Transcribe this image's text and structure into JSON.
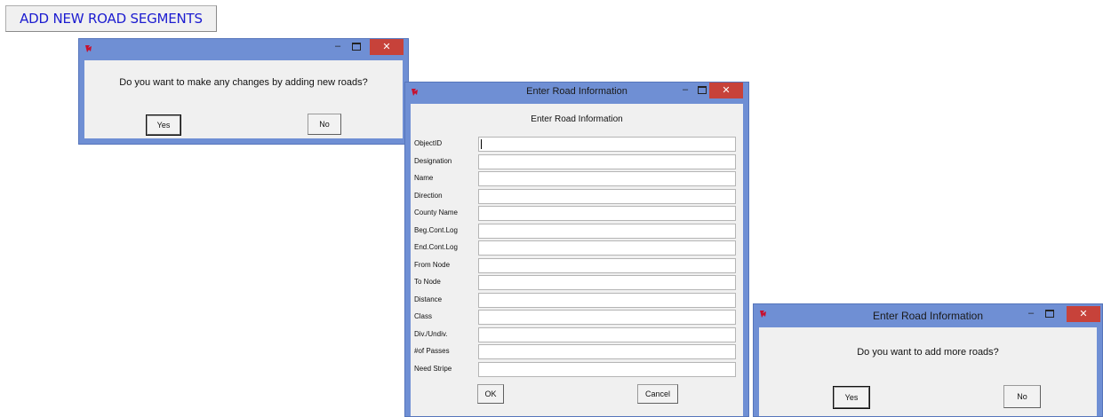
{
  "top_button": {
    "label": "ADD NEW ROAD SEGMENTS"
  },
  "dialog1": {
    "title": "",
    "message": "Do you want to make any changes by adding new roads?",
    "yes_label": "Yes",
    "no_label": "No",
    "icon": "tk-feather-icon"
  },
  "dialog2": {
    "title": "Enter Road Information",
    "heading": "Enter Road Information",
    "fields": [
      {
        "label": "ObjectID",
        "value": ""
      },
      {
        "label": "Designation",
        "value": ""
      },
      {
        "label": "Name",
        "value": ""
      },
      {
        "label": "Direction",
        "value": ""
      },
      {
        "label": "County Name",
        "value": ""
      },
      {
        "label": "Beg.Cont.Log",
        "value": ""
      },
      {
        "label": "End.Cont.Log",
        "value": ""
      },
      {
        "label": "From Node",
        "value": ""
      },
      {
        "label": "To Node",
        "value": ""
      },
      {
        "label": "Distance",
        "value": ""
      },
      {
        "label": "Class",
        "value": ""
      },
      {
        "label": "Div./Undiv.",
        "value": ""
      },
      {
        "label": "#of Passes",
        "value": ""
      },
      {
        "label": "Need Stripe",
        "value": ""
      }
    ],
    "ok_label": "OK",
    "cancel_label": "Cancel"
  },
  "dialog3": {
    "title": "Enter Road Information",
    "message": "Do you want to add more roads?",
    "yes_label": "Yes",
    "no_label": "No"
  },
  "window_controls": {
    "minimize": "–",
    "close": "✕"
  },
  "colors": {
    "title_bar": "#6f8fd4",
    "close": "#c7423a",
    "button_text_blue": "#1c1cd0"
  }
}
